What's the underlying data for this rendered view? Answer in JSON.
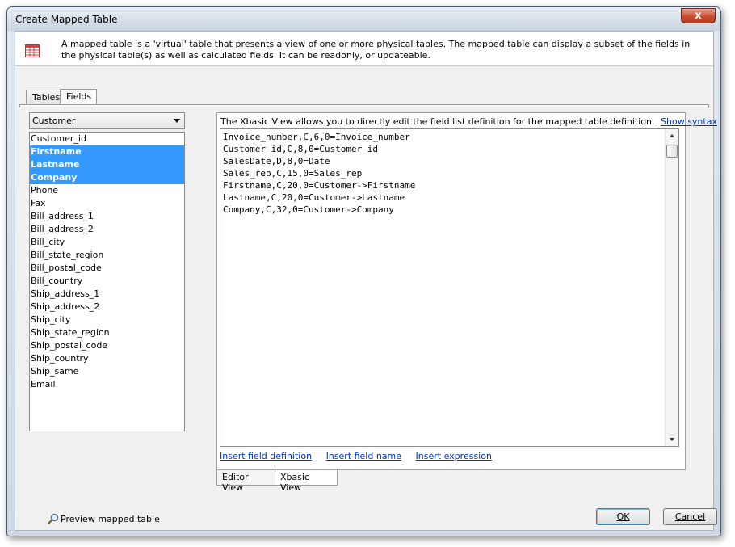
{
  "window": {
    "title": "Create Mapped Table",
    "close_glyph": "x"
  },
  "header": {
    "icon": "table-grid-icon",
    "description": "A mapped table is a 'virtual' table that presents a view of one or more physical tables. The mapped table can display a subset of the fields in the physical table(s) as well as calculated fields. It can be readonly, or updateable."
  },
  "outer_tabs": [
    {
      "label": "Tables",
      "active": false
    },
    {
      "label": "Fields",
      "active": true
    }
  ],
  "table_selector": {
    "value": "Customer"
  },
  "fields": [
    {
      "name": "Customer_id",
      "selected": false
    },
    {
      "name": "Firstname",
      "selected": true
    },
    {
      "name": "Lastname",
      "selected": true
    },
    {
      "name": "Company",
      "selected": true
    },
    {
      "name": "Phone",
      "selected": false
    },
    {
      "name": "Fax",
      "selected": false
    },
    {
      "name": "Bill_address_1",
      "selected": false
    },
    {
      "name": "Bill_address_2",
      "selected": false
    },
    {
      "name": "Bill_city",
      "selected": false
    },
    {
      "name": "Bill_state_region",
      "selected": false
    },
    {
      "name": "Bill_postal_code",
      "selected": false
    },
    {
      "name": "Bill_country",
      "selected": false
    },
    {
      "name": "Ship_address_1",
      "selected": false
    },
    {
      "name": "Ship_address_2",
      "selected": false
    },
    {
      "name": "Ship_city",
      "selected": false
    },
    {
      "name": "Ship_state_region",
      "selected": false
    },
    {
      "name": "Ship_postal_code",
      "selected": false
    },
    {
      "name": "Ship_country",
      "selected": false
    },
    {
      "name": "Ship_same",
      "selected": false
    },
    {
      "name": "Email",
      "selected": false
    }
  ],
  "xbasic_panel": {
    "description": "The Xbasic View allows you to directly edit the field list definition for the mapped table definition.",
    "syntax_link": "Show syntax",
    "editor_lines": [
      "Invoice_number,C,6,0=Invoice_number",
      "Customer_id,C,8,0=Customer_id",
      "SalesDate,D,8,0=Date",
      "Sales_rep,C,15,0=Sales_rep",
      "Firstname,C,20,0=Customer->Firstname",
      "Lastname,C,20,0=Customer->Lastname",
      "Company,C,32,0=Customer->Company"
    ],
    "links": [
      "Insert field definition",
      "Insert field name",
      "Insert expression"
    ]
  },
  "editor_tabs": [
    {
      "label": "Editor View",
      "active": false
    },
    {
      "label": "Xbasic View",
      "active": true
    }
  ],
  "footer": {
    "preview_label": "Preview mapped table",
    "preview_icon": "magnifier-icon",
    "ok_label": "OK",
    "cancel_label": "Cancel"
  },
  "colors": {
    "selection": "#3399ff",
    "link": "#0033cc",
    "close_button": "#c94d33"
  }
}
